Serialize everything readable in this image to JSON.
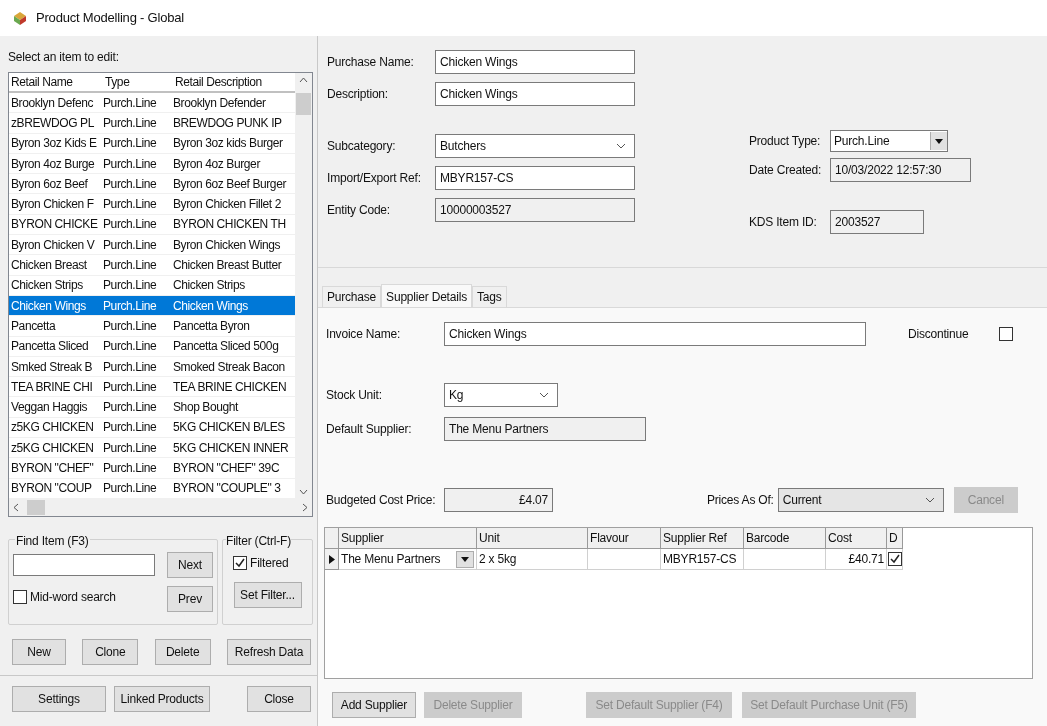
{
  "window": {
    "title": "Product Modelling - Global"
  },
  "item_list": {
    "label": "Select an item to edit:",
    "columns": [
      "Retail Name",
      "Type",
      "Retail Description"
    ],
    "rows": [
      {
        "name": "Brooklyn Defenc",
        "type": "Purch.Line",
        "description": "Brooklyn Defender",
        "selected": false
      },
      {
        "name": "zBREWDOG PL",
        "type": "Purch.Line",
        "description": "BREWDOG PUNK IP",
        "selected": false
      },
      {
        "name": "Byron 3oz Kids E",
        "type": "Purch.Line",
        "description": "Byron 3oz kids Burger",
        "selected": false
      },
      {
        "name": "Byron 4oz Burge",
        "type": "Purch.Line",
        "description": "Byron 4oz Burger",
        "selected": false
      },
      {
        "name": "Byron 6oz Beef",
        "type": "Purch.Line",
        "description": "Byron 6oz Beef Burger",
        "selected": false
      },
      {
        "name": "Byron Chicken F",
        "type": "Purch.Line",
        "description": "Byron Chicken Fillet 2",
        "selected": false
      },
      {
        "name": "BYRON CHICKE",
        "type": "Purch.Line",
        "description": "BYRON CHICKEN TH",
        "selected": false
      },
      {
        "name": "Byron Chicken V",
        "type": "Purch.Line",
        "description": "Byron Chicken Wings",
        "selected": false
      },
      {
        "name": "Chicken Breast",
        "type": "Purch.Line",
        "description": "Chicken Breast Butter",
        "selected": false
      },
      {
        "name": "Chicken Strips",
        "type": "Purch.Line",
        "description": "Chicken Strips",
        "selected": false
      },
      {
        "name": "Chicken Wings",
        "type": "Purch.Line",
        "description": "Chicken Wings",
        "selected": true
      },
      {
        "name": "Pancetta",
        "type": "Purch.Line",
        "description": "Pancetta Byron",
        "selected": false
      },
      {
        "name": "Pancetta Sliced",
        "type": "Purch.Line",
        "description": "Pancetta Sliced 500g",
        "selected": false
      },
      {
        "name": "Smked Streak B",
        "type": "Purch.Line",
        "description": "Smoked Streak Bacon",
        "selected": false
      },
      {
        "name": "TEA BRINE CHI",
        "type": "Purch.Line",
        "description": "TEA BRINE CHICKEN",
        "selected": false
      },
      {
        "name": "Veggan Haggis",
        "type": "Purch.Line",
        "description": "Shop Bought",
        "selected": false
      },
      {
        "name": "z5KG CHICKEN",
        "type": "Purch.Line",
        "description": "5KG CHICKEN B/LES",
        "selected": false
      },
      {
        "name": "z5KG CHICKEN",
        "type": "Purch.Line",
        "description": "5KG CHICKEN INNER",
        "selected": false
      },
      {
        "name": "BYRON \"CHEF\"",
        "type": "Purch.Line",
        "description": "BYRON \"CHEF\" 39C",
        "selected": false
      },
      {
        "name": "BYRON \"COUP",
        "type": "Purch.Line",
        "description": "BYRON \"COUPLE\" 3",
        "selected": false
      }
    ]
  },
  "find": {
    "title": "Find Item (F3)",
    "next": "Next",
    "prev": "Prev",
    "mid_word": {
      "label": "Mid-word search",
      "checked": false
    }
  },
  "filter": {
    "title": "Filter (Ctrl-F)",
    "filtered": {
      "label": "Filtered",
      "checked": true
    },
    "button": "Set Filter..."
  },
  "item_buttons": [
    "New",
    "Clone",
    "Delete",
    "Refresh Data"
  ],
  "footer_buttons": [
    "Settings",
    "Linked Products",
    "Close"
  ],
  "details": {
    "purchase_name": {
      "label": "Purchase Name:",
      "value": "Chicken Wings"
    },
    "description": {
      "label": "Description:",
      "value": "Chicken Wings"
    },
    "subcategory": {
      "label": "Subcategory:",
      "value": "Butchers"
    },
    "import_export_ref": {
      "label": "Import/Export Ref:",
      "value": "MBYR157-CS"
    },
    "entity_code": {
      "label": "Entity Code:",
      "value": "10000003527"
    },
    "product_type": {
      "label": "Product Type:",
      "value": "Purch.Line"
    },
    "date_created": {
      "label": "Date Created:",
      "value": "10/03/2022 12:57:30"
    },
    "kds_item_id": {
      "label": "KDS Item ID:",
      "value": "2003527"
    }
  },
  "tabs": [
    {
      "label": "Purchase",
      "selected": false
    },
    {
      "label": "Supplier Details",
      "selected": true
    },
    {
      "label": "Tags",
      "selected": false
    }
  ],
  "supplier_details": {
    "invoice_name": {
      "label": "Invoice Name:",
      "value": "Chicken Wings"
    },
    "discontinue": {
      "label": "Discontinue",
      "checked": false
    },
    "stock_unit": {
      "label": "Stock Unit:",
      "value": "Kg"
    },
    "default_supplier": {
      "label": "Default Supplier:",
      "value": "The Menu Partners"
    },
    "budgeted_cost": {
      "label": "Budgeted Cost Price:",
      "value": "£4.07"
    },
    "prices_as_of": {
      "label": "Prices As Of:",
      "value": "Current"
    },
    "cancel": {
      "label": "Cancel",
      "disabled": true
    }
  },
  "supplier_table": {
    "columns": [
      "Supplier",
      "Unit",
      "Flavour",
      "Supplier Ref",
      "Barcode",
      "Cost",
      "D"
    ],
    "rows": [
      {
        "supplier": "The Menu Partners",
        "unit": "2 x 5kg",
        "flavour": "",
        "supplier_ref": "MBYR157-CS",
        "barcode": "",
        "cost": "£40.71",
        "default": true
      }
    ]
  },
  "supplier_buttons": [
    {
      "label": "Add Supplier",
      "disabled": false
    },
    {
      "label": "Delete Supplier",
      "disabled": true
    },
    {
      "label": "Set Default Supplier (F4)",
      "disabled": true
    },
    {
      "label": "Set Default Purchase Unit (F5)",
      "disabled": true
    }
  ]
}
